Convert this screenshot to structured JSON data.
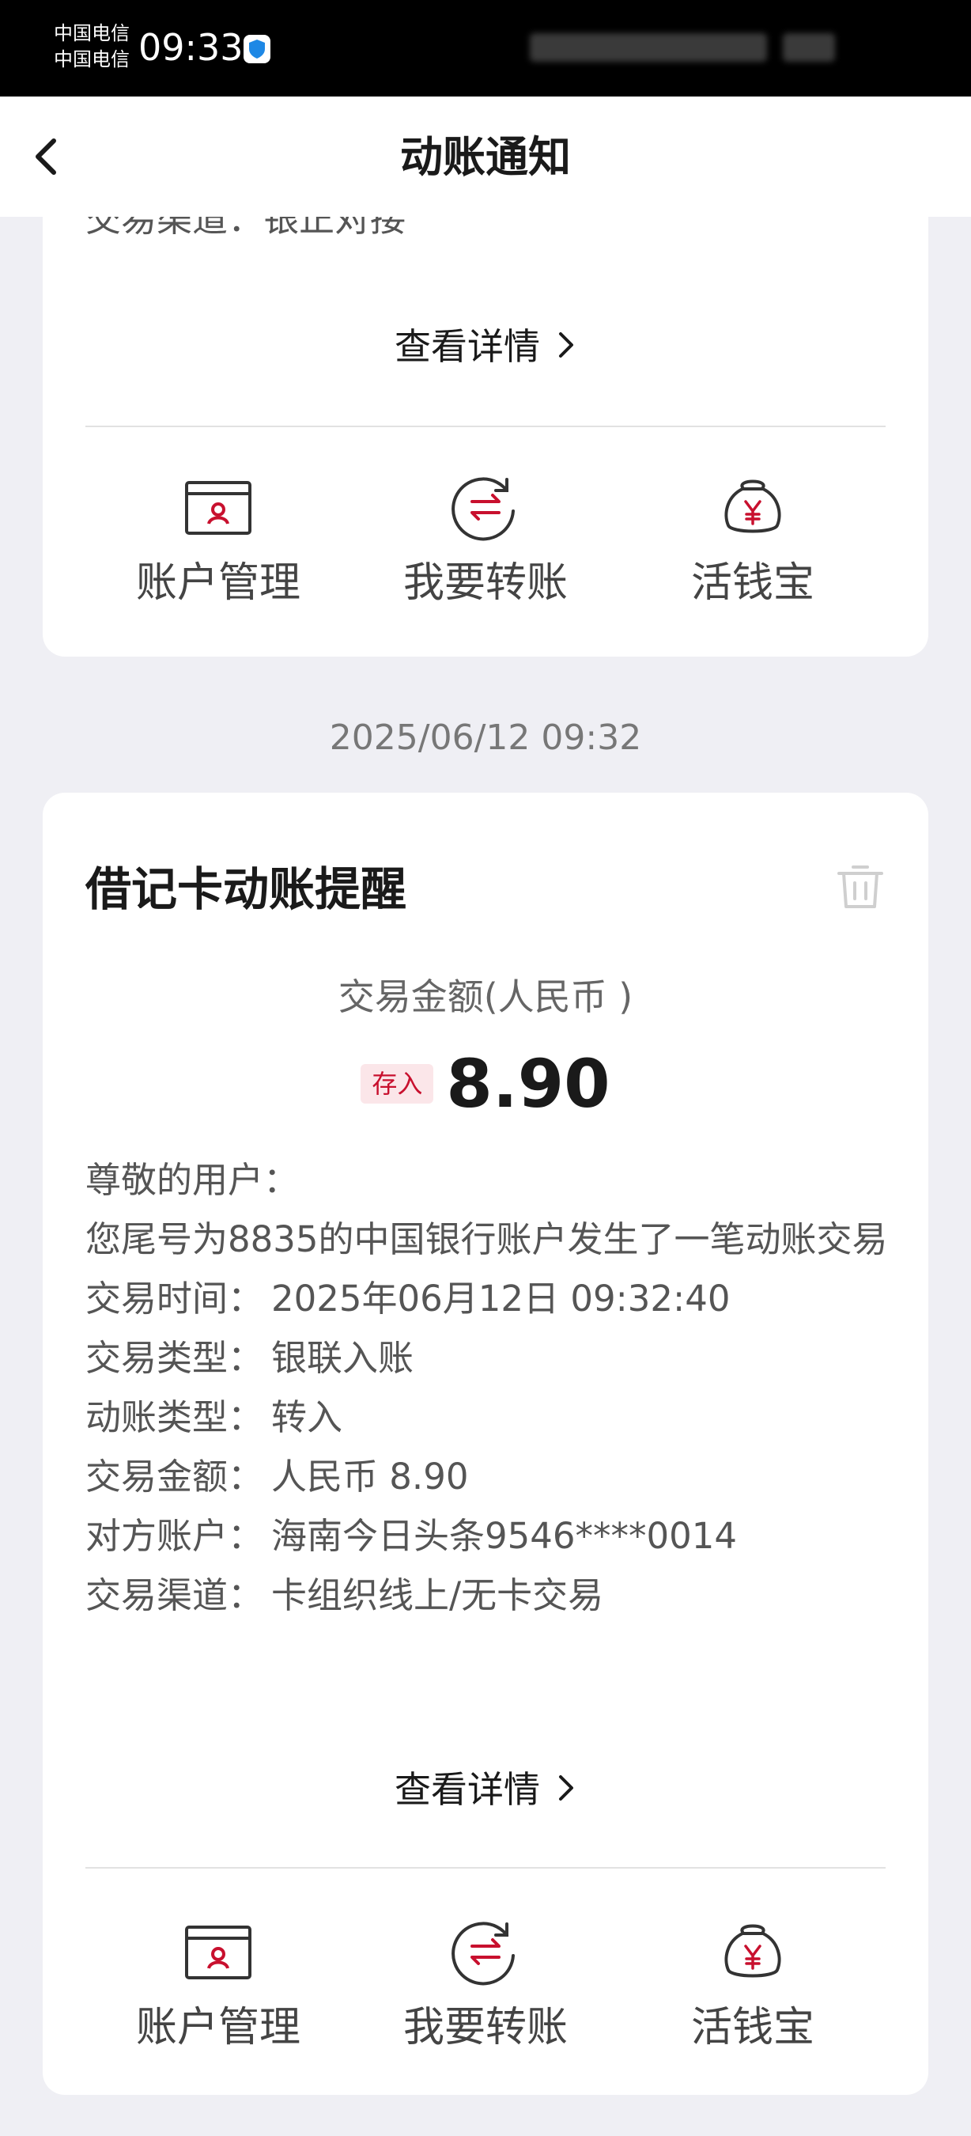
{
  "status_bar": {
    "carrier_1": "中国电信",
    "carrier_2": "中国电信",
    "time": "09:33"
  },
  "nav": {
    "title": "动账通知"
  },
  "previous_card": {
    "clipped_line": "交易渠道：银正对接",
    "view_details": "查看详情",
    "actions": [
      {
        "label": "账户管理",
        "icon": "account-card-icon"
      },
      {
        "label": "我要转账",
        "icon": "transfer-icon"
      },
      {
        "label": "活钱宝",
        "icon": "money-bag-icon"
      }
    ]
  },
  "date_stamp": "2025/06/12 09:32",
  "notification": {
    "title": "借记卡动账提醒",
    "amount_label": "交易金额(人民币 )",
    "deposit_tag": "存入",
    "amount": "8.90",
    "greeting": "尊敬的用户：",
    "message": "您尾号为8835的中国银行账户发生了一笔动账交易",
    "fields": [
      {
        "key": "交易时间：",
        "value": "2025年06月12日 09:32:40"
      },
      {
        "key": "交易类型：",
        "value": "银联入账"
      },
      {
        "key": "动账类型：",
        "value": "转入"
      },
      {
        "key": "交易金额：",
        "value": "人民币 8.90"
      },
      {
        "key": "对方账户：",
        "value": "海南今日头条9546****0014"
      },
      {
        "key": "交易渠道：",
        "value": "卡组织线上/无卡交易"
      }
    ],
    "view_details": "查看详情",
    "actions": [
      {
        "label": "账户管理",
        "icon": "account-card-icon"
      },
      {
        "label": "我要转账",
        "icon": "transfer-icon"
      },
      {
        "label": "活钱宝",
        "icon": "money-bag-icon"
      }
    ]
  },
  "colors": {
    "accent": "#c8102e",
    "background": "#efeff4",
    "card": "#ffffff"
  }
}
